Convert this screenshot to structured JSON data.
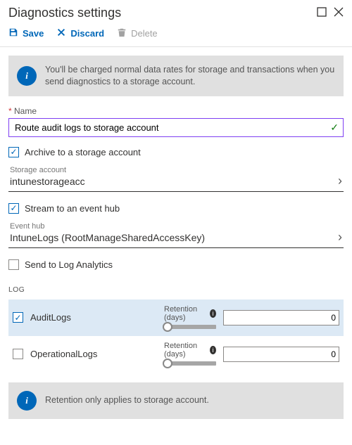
{
  "header": {
    "title": "Diagnostics settings"
  },
  "toolbar": {
    "save_label": "Save",
    "discard_label": "Discard",
    "delete_label": "Delete"
  },
  "info_top": "You'll be charged normal data rates for storage and transactions when you send diagnostics to a storage account.",
  "name_field": {
    "label": "Name",
    "value": "Route audit logs to storage account"
  },
  "options": {
    "archive_label": "Archive to a storage account",
    "archive_checked": true,
    "storage_picker": {
      "label": "Storage account",
      "value": "intunestorageacc"
    },
    "stream_label": "Stream to an event hub",
    "stream_checked": true,
    "eventhub_picker": {
      "label": "Event hub",
      "value": "IntuneLogs (RootManageSharedAccessKey)"
    },
    "loganalytics_label": "Send to Log Analytics",
    "loganalytics_checked": false
  },
  "log_section": {
    "heading": "LOG",
    "retention_label": "Retention (days)",
    "rows": [
      {
        "name": "AuditLogs",
        "checked": true,
        "retention": "0"
      },
      {
        "name": "OperationalLogs",
        "checked": false,
        "retention": "0"
      }
    ]
  },
  "info_bottom": "Retention only applies to storage account.",
  "colors": {
    "accent": "#0067b8",
    "focus": "#7e3ff2"
  }
}
